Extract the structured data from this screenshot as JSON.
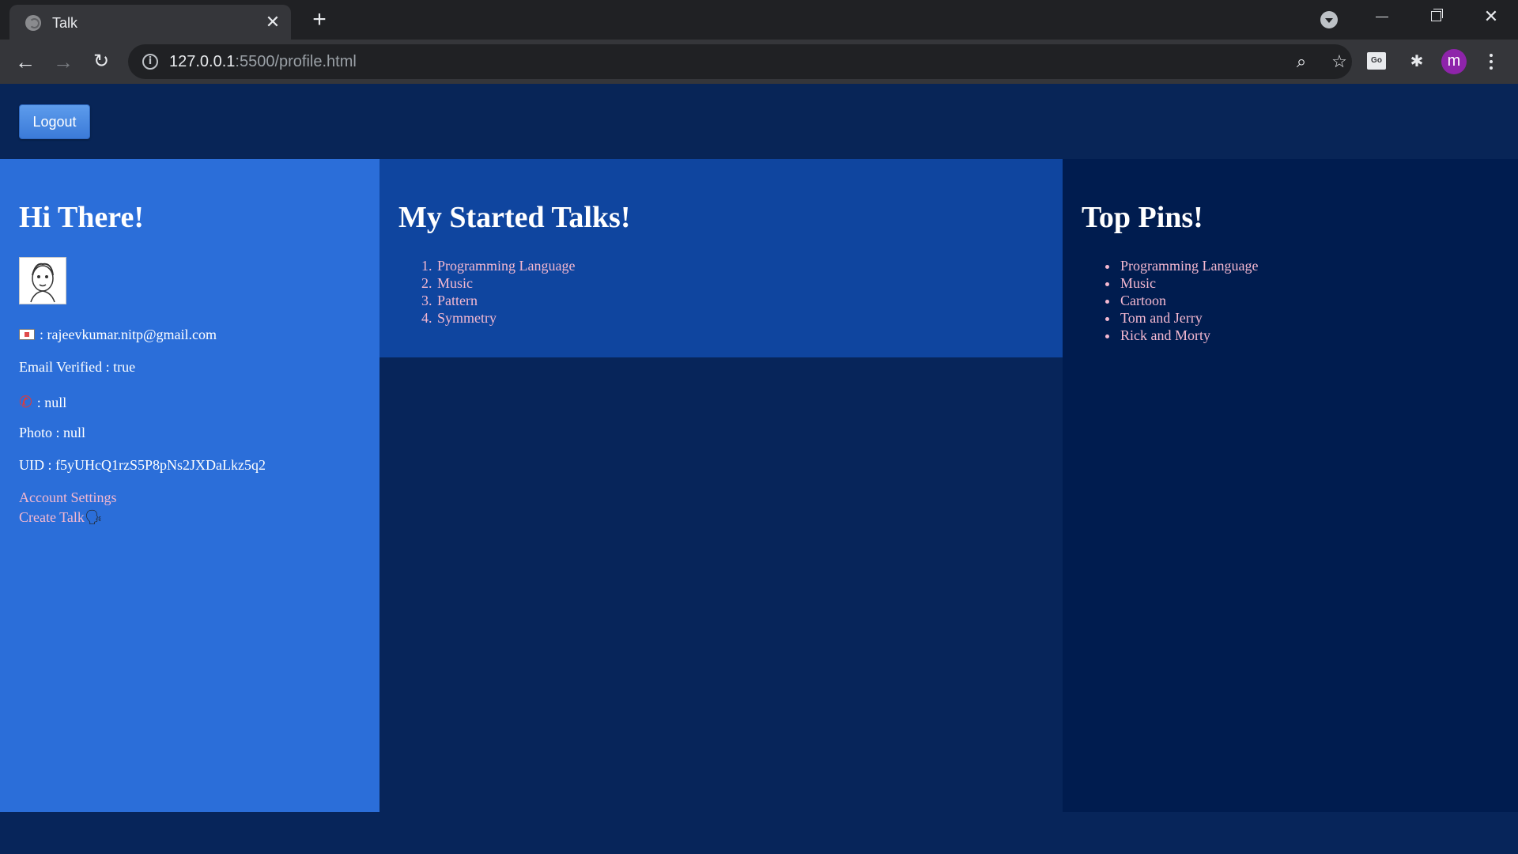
{
  "browser": {
    "tab_title": "Talk",
    "tab_close": "✕",
    "new_tab": "+",
    "url_host": "127.0.0.1",
    "url_rest": ":5500/profile.html",
    "avatar_letter": "m",
    "translate_label": "Go"
  },
  "page": {
    "logout_label": "Logout",
    "left": {
      "heading": "Hi There!",
      "email": ": rajeevkumar.nitp@gmail.com",
      "email_verified": "Email Verified : true",
      "phone": ": null",
      "photo": "Photo : null",
      "uid": "UID : f5yUHcQ1rzS5P8pNs2JXDaLkz5q2",
      "account_settings": "Account Settings",
      "create_talk": "Create Talk"
    },
    "middle": {
      "heading": "My Started Talks!",
      "talks": [
        "Programming Language",
        "Music",
        "Pattern",
        "Symmetry"
      ]
    },
    "right": {
      "heading": "Top Pins!",
      "pins": [
        "Programming Language",
        "Music",
        "Cartoon",
        "Tom and Jerry",
        "Rick and Morty"
      ]
    }
  },
  "colors": {
    "page_bg": "#07255a",
    "left_panel": "#2b6ed9",
    "middle_panel": "#0f459f",
    "right_panel": "#001c4f",
    "link": "#f4b8d0"
  }
}
